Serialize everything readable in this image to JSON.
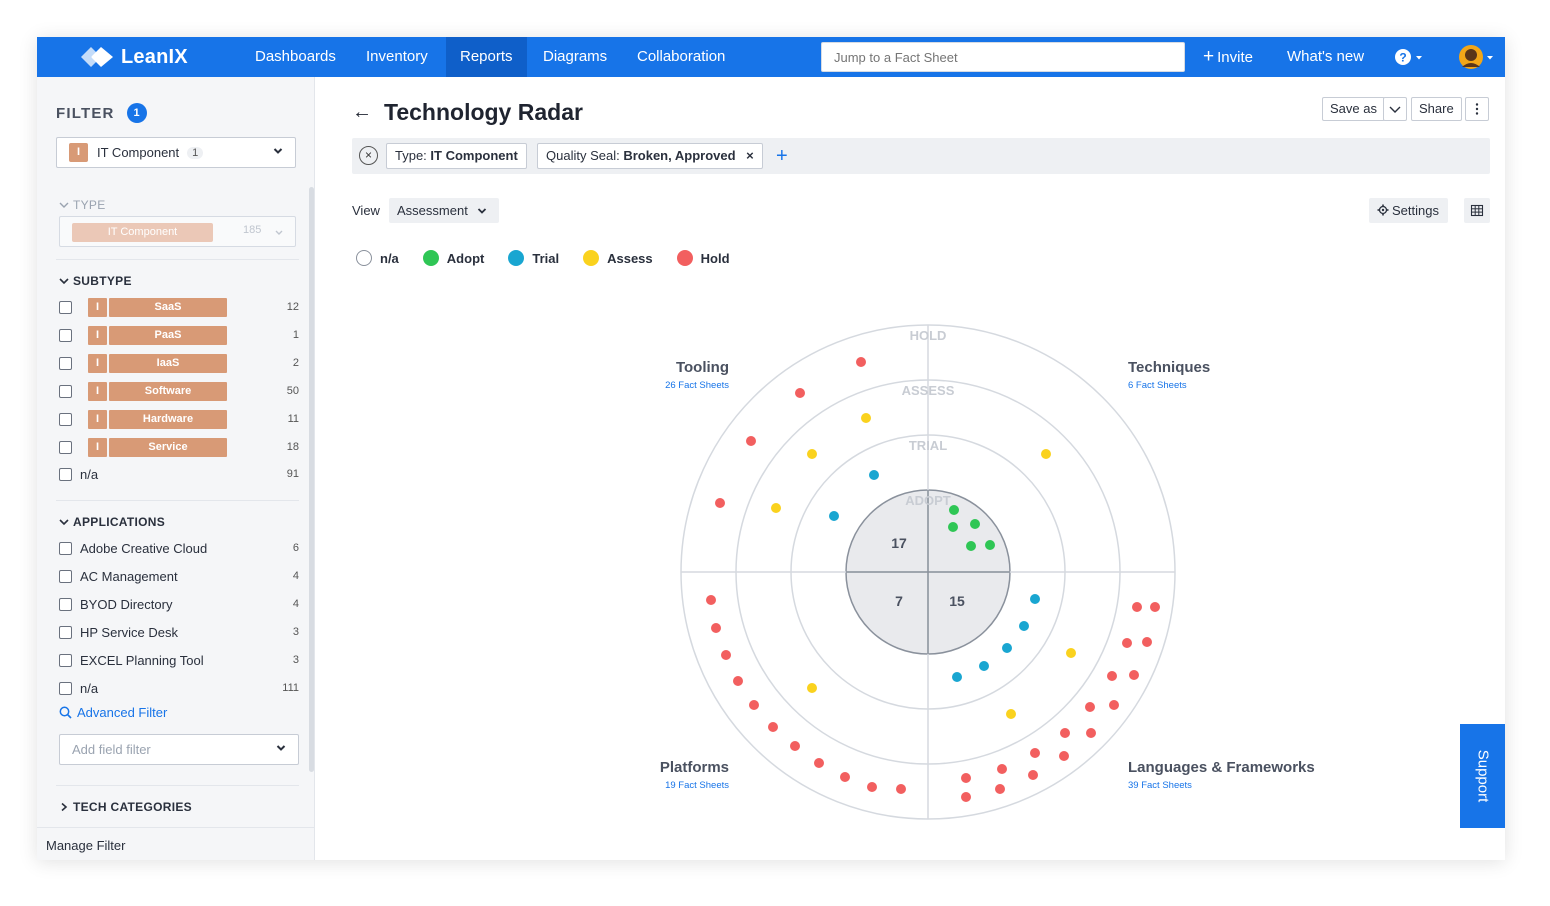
{
  "nav": {
    "brand": "LeanIX",
    "items": [
      {
        "label": "Dashboards",
        "active": false
      },
      {
        "label": "Inventory",
        "active": false
      },
      {
        "label": "Reports",
        "active": true
      },
      {
        "label": "Diagrams",
        "active": false
      },
      {
        "label": "Collaboration",
        "active": false
      }
    ],
    "search_placeholder": "Jump to a Fact Sheet",
    "invite": "Invite",
    "whats_new": "What's new"
  },
  "sidebar": {
    "filter_title": "FILTER",
    "filter_count": "1",
    "factsheet_type": {
      "label": "IT Component",
      "count": "1"
    },
    "type_section": {
      "title": "TYPE",
      "chip": "IT Component",
      "count": "185"
    },
    "subtype_section": {
      "title": "SUBTYPE",
      "items": [
        {
          "label": "SaaS",
          "count": "12"
        },
        {
          "label": "PaaS",
          "count": "1"
        },
        {
          "label": "IaaS",
          "count": "2"
        },
        {
          "label": "Software",
          "count": "50"
        },
        {
          "label": "Hardware",
          "count": "11"
        },
        {
          "label": "Service",
          "count": "18"
        }
      ],
      "na": {
        "label": "n/a",
        "count": "91"
      }
    },
    "applications_section": {
      "title": "APPLICATIONS",
      "items": [
        {
          "label": "Adobe Creative Cloud",
          "count": "6"
        },
        {
          "label": "AC Management",
          "count": "4"
        },
        {
          "label": "BYOD Directory",
          "count": "4"
        },
        {
          "label": "HP Service Desk",
          "count": "3"
        },
        {
          "label": "EXCEL Planning Tool",
          "count": "3"
        },
        {
          "label": "n/a",
          "count": "111"
        }
      ]
    },
    "advanced_filter": "Advanced Filter",
    "add_field_placeholder": "Add field filter",
    "tech_categories": "TECH CATEGORIES",
    "manage_filter": "Manage Filter"
  },
  "main": {
    "title": "Technology Radar",
    "save_as": "Save as",
    "share": "Share",
    "filters": [
      {
        "key": "Type:",
        "value": "IT Component"
      },
      {
        "key": "Quality Seal:",
        "value": "Broken, Approved"
      }
    ],
    "view_label": "View",
    "view_value": "Assessment",
    "settings": "Settings",
    "legend": [
      {
        "label": "n/a",
        "color": "#ffffff"
      },
      {
        "label": "Adopt",
        "color": "#2fc655"
      },
      {
        "label": "Trial",
        "color": "#19a6d1"
      },
      {
        "label": "Assess",
        "color": "#fad21e"
      },
      {
        "label": "Hold",
        "color": "#f25f5f"
      }
    ],
    "support": "Support"
  },
  "radar": {
    "rings": [
      "HOLD",
      "ASSESS",
      "TRIAL",
      "ADOPT"
    ],
    "quadrants": [
      {
        "name": "Tooling",
        "sub": "26 Fact Sheets"
      },
      {
        "name": "Techniques",
        "sub": "6 Fact Sheets"
      },
      {
        "name": "Platforms",
        "sub": "19 Fact Sheets"
      },
      {
        "name": "Languages & Frameworks",
        "sub": "39 Fact Sheets"
      }
    ],
    "center_counts": {
      "top_left": "17",
      "bottom_left": "7",
      "bottom_right": "15"
    },
    "colors": {
      "adopt": "#2fc655",
      "trial": "#19a6d1",
      "assess": "#fad21e",
      "hold": "#f25f5f"
    }
  }
}
